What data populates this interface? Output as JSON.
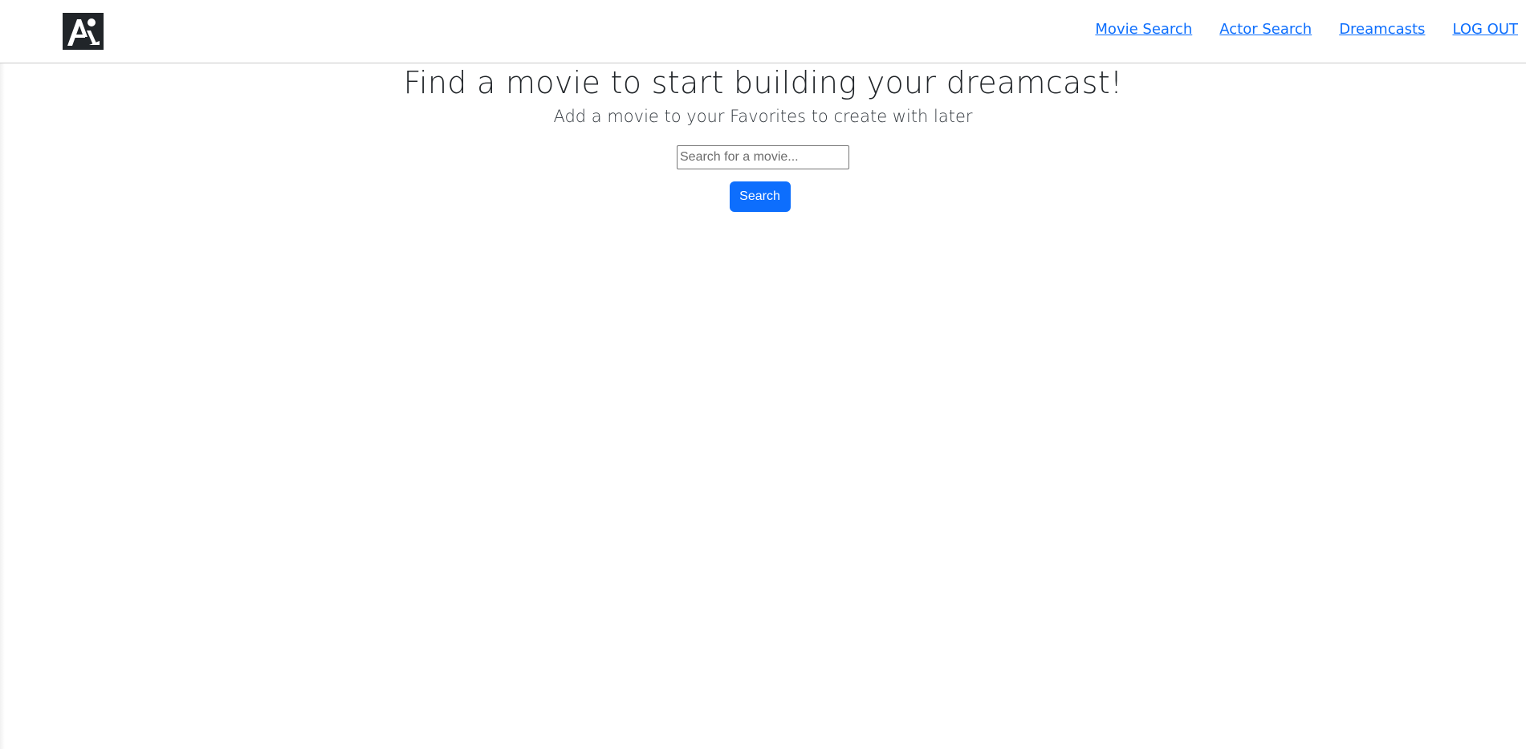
{
  "nav": {
    "logo_icon": "dreamcast-logo-icon",
    "links": [
      {
        "label": "Movie Search"
      },
      {
        "label": "Actor Search"
      },
      {
        "label": "Dreamcasts"
      },
      {
        "label": "LOG OUT"
      }
    ],
    "link_color": "#0d6efd"
  },
  "main": {
    "title": "Find a movie to start building your dreamcast!",
    "subtitle": "Add a movie to your Favorites to create with later",
    "search": {
      "placeholder": "Search for a movie...",
      "value": "",
      "button_label": "Search",
      "button_color": "#0d6efd"
    }
  }
}
